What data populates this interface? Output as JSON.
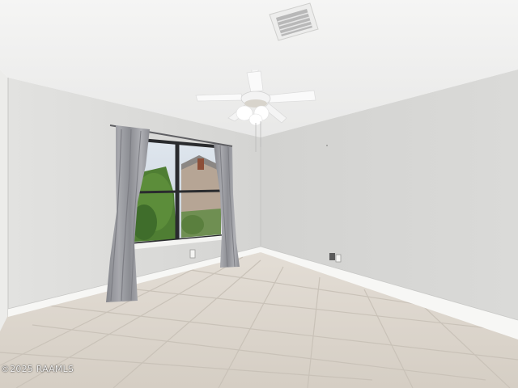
{
  "watermark": {
    "text": "©2025 RAAMLS"
  },
  "colors": {
    "ceiling": "#f2f2f1",
    "wall_left": "#dcdcda",
    "wall_right": "#d6d6d4",
    "baseboard": "#f6f6f4",
    "floor": "#dcd6ce",
    "grout": "#cbc4ba",
    "curtain": "#9b9ca2",
    "window_frame": "#2a2b2e",
    "fan": "#f7f7f7",
    "vent": "#e9e9e9"
  },
  "icons": [
    "ceiling-fan",
    "air-vent",
    "wall-outlet",
    "curtain-rod"
  ]
}
